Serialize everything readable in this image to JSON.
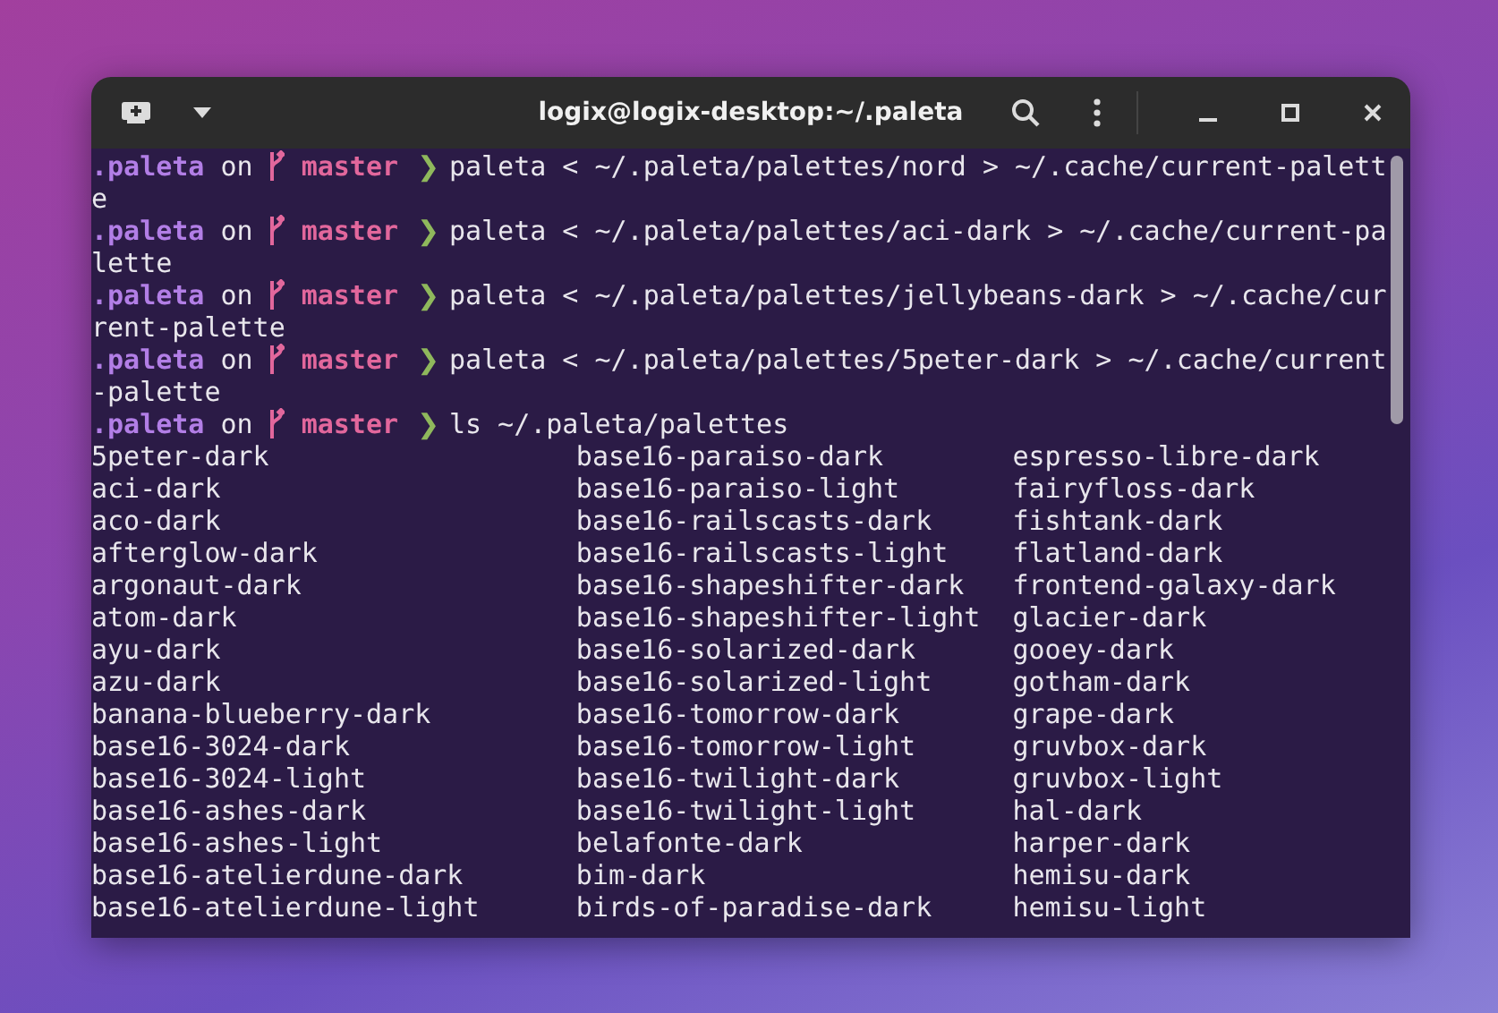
{
  "window": {
    "title": "logix@logix-desktop:~/.paleta"
  },
  "terminal": {
    "lines": [
      {
        "kind": "prompt",
        "dir": ".paleta",
        "on": "on",
        "branch": "master",
        "chevron": "❯",
        "command": "paleta < ~/.paleta/palettes/nord > ~/.cache/current-palett"
      },
      {
        "kind": "text",
        "text": "e"
      },
      {
        "kind": "prompt",
        "dir": ".paleta",
        "on": "on",
        "branch": "master",
        "chevron": "❯",
        "command": "paleta < ~/.paleta/palettes/aci-dark > ~/.cache/current-pa"
      },
      {
        "kind": "text",
        "text": "lette"
      },
      {
        "kind": "prompt",
        "dir": ".paleta",
        "on": "on",
        "branch": "master",
        "chevron": "❯",
        "command": "paleta < ~/.paleta/palettes/jellybeans-dark > ~/.cache/cur"
      },
      {
        "kind": "text",
        "text": "rent-palette"
      },
      {
        "kind": "prompt",
        "dir": ".paleta",
        "on": "on",
        "branch": "master",
        "chevron": "❯",
        "command": "paleta < ~/.paleta/palettes/5peter-dark > ~/.cache/current"
      },
      {
        "kind": "text",
        "text": "-palette"
      },
      {
        "kind": "prompt",
        "dir": ".paleta",
        "on": "on",
        "branch": "master",
        "chevron": "❯",
        "command": "ls ~/.paleta/palettes"
      }
    ],
    "listing": [
      [
        "5peter-dark",
        "base16-paraiso-dark",
        "espresso-libre-dark"
      ],
      [
        "aci-dark",
        "base16-paraiso-light",
        "fairyfloss-dark"
      ],
      [
        "aco-dark",
        "base16-railscasts-dark",
        "fishtank-dark"
      ],
      [
        "afterglow-dark",
        "base16-railscasts-light",
        "flatland-dark"
      ],
      [
        "argonaut-dark",
        "base16-shapeshifter-dark",
        "frontend-galaxy-dark"
      ],
      [
        "atom-dark",
        "base16-shapeshifter-light",
        "glacier-dark"
      ],
      [
        "ayu-dark",
        "base16-solarized-dark",
        "gooey-dark"
      ],
      [
        "azu-dark",
        "base16-solarized-light",
        "gotham-dark"
      ],
      [
        "banana-blueberry-dark",
        "base16-tomorrow-dark",
        "grape-dark"
      ],
      [
        "base16-3024-dark",
        "base16-tomorrow-light",
        "gruvbox-dark"
      ],
      [
        "base16-3024-light",
        "base16-twilight-dark",
        "gruvbox-light"
      ],
      [
        "base16-ashes-dark",
        "base16-twilight-light",
        "hal-dark"
      ],
      [
        "base16-ashes-light",
        "belafonte-dark",
        "harper-dark"
      ],
      [
        "base16-atelierdune-dark",
        "bim-dark",
        "hemisu-dark"
      ],
      [
        "base16-atelierdune-light",
        "birds-of-paradise-dark",
        "hemisu-light"
      ]
    ]
  }
}
